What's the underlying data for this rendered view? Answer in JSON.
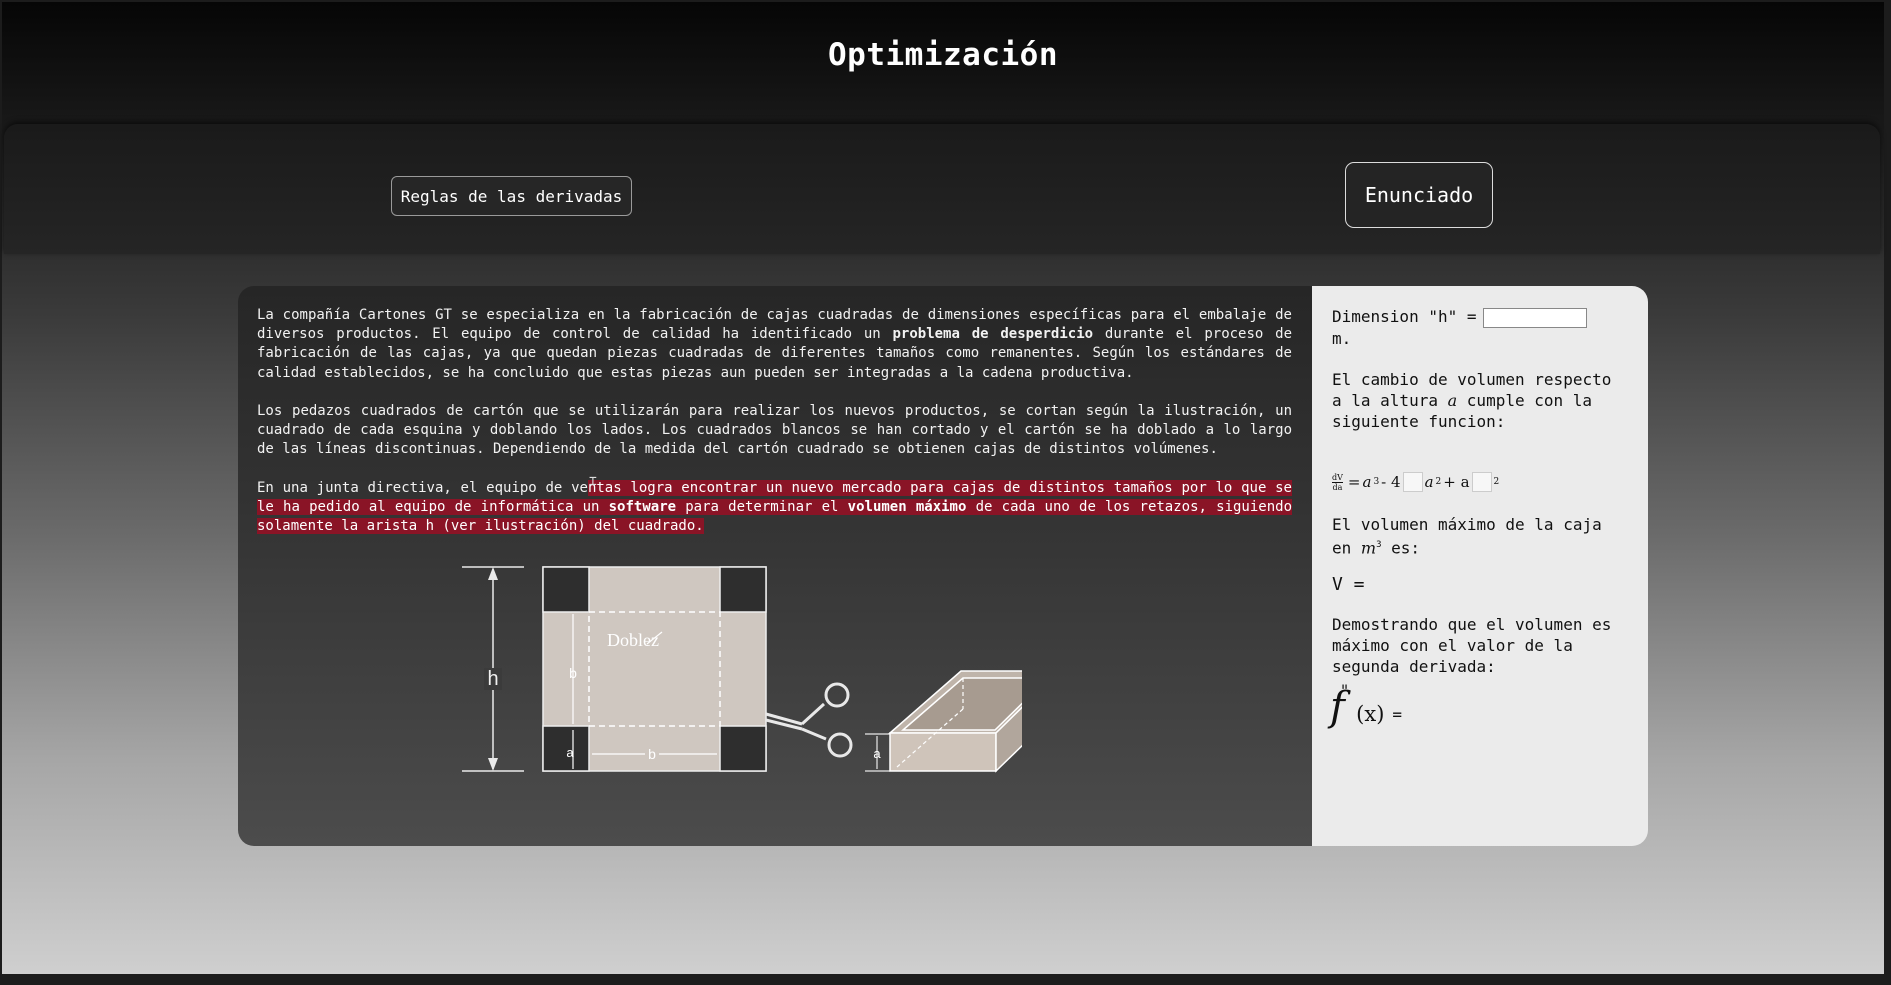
{
  "page": {
    "title": "Optimización"
  },
  "buttons": {
    "rules": "Reglas de las derivadas",
    "statement": "Enunciado"
  },
  "statement": {
    "p1": [
      "La compañía Cartones GT se especializa en la fabricación de cajas cuadradas de dimensiones específicas para el embalaje de diversos productos. El equipo de control de calidad ha identificado un ",
      "problema de desperdicio",
      " durante el proceso de fabricación de las cajas, ya que quedan piezas cuadradas de diferentes tamaños como remanentes. Según los estándares de calidad establecidos, se ha concluido que estas piezas aun pueden ser integradas a la cadena productiva."
    ],
    "p2": "Los pedazos cuadrados de cartón que se utilizarán para realizar los nuevos productos, se cortan según la ilustración, un cuadrado de cada esquina y doblando los lados. Los cuadrados blancos se han cortado y el cartón se ha doblado a lo largo de las líneas discontinuas. Dependiendo de la medida del cartón cuadrado se obtienen cajas de distintos volúmenes.",
    "p3": [
      "En una junta directiva, el equipo de ve",
      "ntas logra encontrar un nuevo mercado para cajas de distintos tamaños por lo que se le ha pedido al equipo de informática un ",
      "software",
      " para determinar el ",
      "volumen máximo",
      " de cada uno de los retazos, siguiendo solamente la arista h (ver ilustración) del cuadrado."
    ]
  },
  "illustration": {
    "fold_label": "Doblez",
    "h_label": "h",
    "a_label": "a",
    "b_label": "b"
  },
  "panel": {
    "dimension_label": "Dimension \"h\" =",
    "dimension_value": "",
    "unit": "m.",
    "change_text": "El cambio de volumen respecto a la altura",
    "change_var": "a",
    "change_tail": "cumple con la siguiente funcion:",
    "formula": {
      "frac_top": "dV",
      "frac_bottom": "da",
      "eq": "=",
      "a3": "a",
      "exp3": "3",
      "minus": "- 4",
      "a2": "a",
      "exp2": "2",
      "plus": "+ a",
      "exp_last": "2"
    },
    "max_text": "El volumen máximo de la caja en",
    "max_unit": "m",
    "max_unit_exp": "3",
    "max_tail": "es:",
    "v_label": "V =",
    "second_deriv_text": "Demostrando que el volumen es máximo con el valor de la segunda derivada:",
    "fpp": {
      "f": "f",
      "primes": "\"",
      "arg": "(x)",
      "eq": "="
    }
  }
}
